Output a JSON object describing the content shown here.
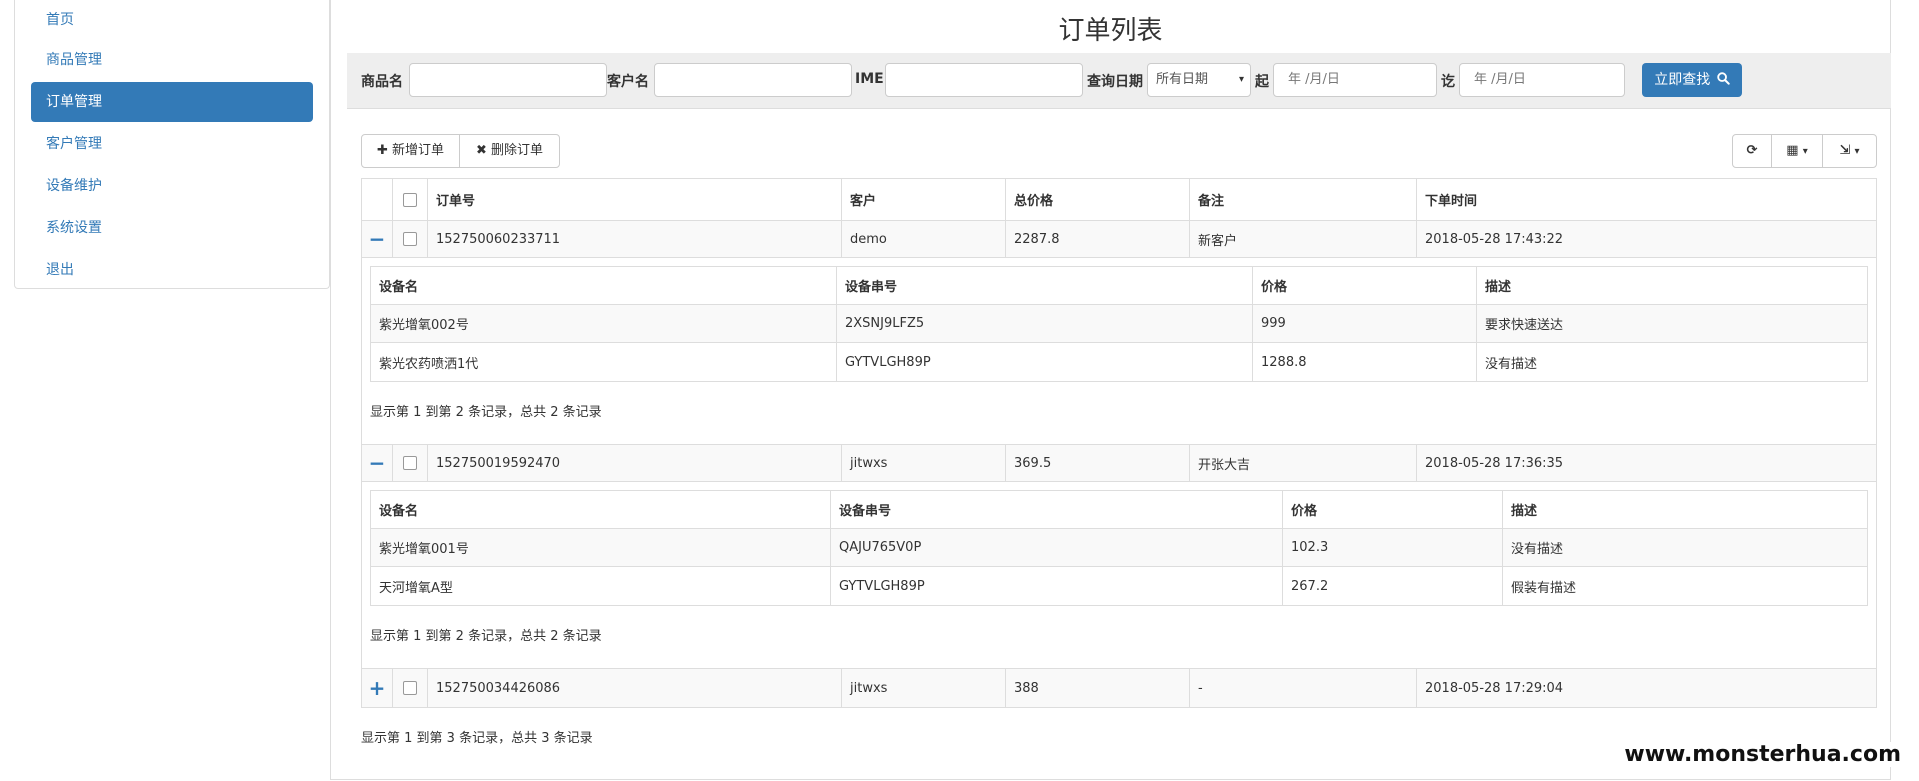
{
  "sidebar": {
    "items": [
      {
        "label": "首页"
      },
      {
        "label": "商品管理"
      },
      {
        "label": "订单管理",
        "active": true
      },
      {
        "label": "客户管理"
      },
      {
        "label": "设备维护"
      },
      {
        "label": "系统设置"
      },
      {
        "label": "退出"
      }
    ]
  },
  "page": {
    "title": "订单列表"
  },
  "filters": {
    "product_label": "商品名",
    "customer_label": "客户名",
    "imei_label": "IMEI",
    "date_label": "查询日期",
    "date_select_value": "所有日期",
    "from_label": "起",
    "to_label": "讫",
    "date_placeholder": "年 /月/日",
    "search_button": "立即查找"
  },
  "toolbar": {
    "add_order": "新增订单",
    "delete_order": "删除订单"
  },
  "table": {
    "headers": [
      "订单号",
      "客户",
      "总价格",
      "备注",
      "下单时间"
    ],
    "rows": [
      {
        "toggle": "−",
        "order_no": "152750060233711",
        "customer": "demo",
        "total": "2287.8",
        "note": "新客户",
        "time": "2018-05-28 17:43:22",
        "detail_headers": [
          "设备名",
          "设备串号",
          "价格",
          "描述"
        ],
        "details": [
          [
            "紫光增氧002号",
            "2XSNJ9LFZ5",
            "999",
            "要求快速送达"
          ],
          [
            "紫光农药喷洒1代",
            "GYTVLGH89P",
            "1288.8",
            "没有描述"
          ]
        ],
        "summary": "显示第 1 到第 2 条记录，总共 2 条记录"
      },
      {
        "toggle": "−",
        "order_no": "152750019592470",
        "customer": "jitwxs",
        "total": "369.5",
        "note": "开张大吉",
        "time": "2018-05-28 17:36:35",
        "detail_headers": [
          "设备名",
          "设备串号",
          "价格",
          "描述"
        ],
        "details": [
          [
            "紫光增氧001号",
            "QAJU765V0P",
            "102.3",
            "没有描述"
          ],
          [
            "天河增氧A型",
            "GYTVLGH89P",
            "267.2",
            "假装有描述"
          ]
        ],
        "summary": "显示第 1 到第 2 条记录，总共 2 条记录"
      },
      {
        "toggle": "+",
        "order_no": "152750034426086",
        "customer": "jitwxs",
        "total": "388",
        "note": "-",
        "time": "2018-05-28 17:29:04"
      }
    ],
    "summary": "显示第 1 到第 3 条记录，总共 3 条记录"
  },
  "watermark": "www.monsterhua.com",
  "colors": {
    "primary": "#337ab7",
    "filter_bg": "#eeeeee",
    "border": "#dddddd"
  }
}
